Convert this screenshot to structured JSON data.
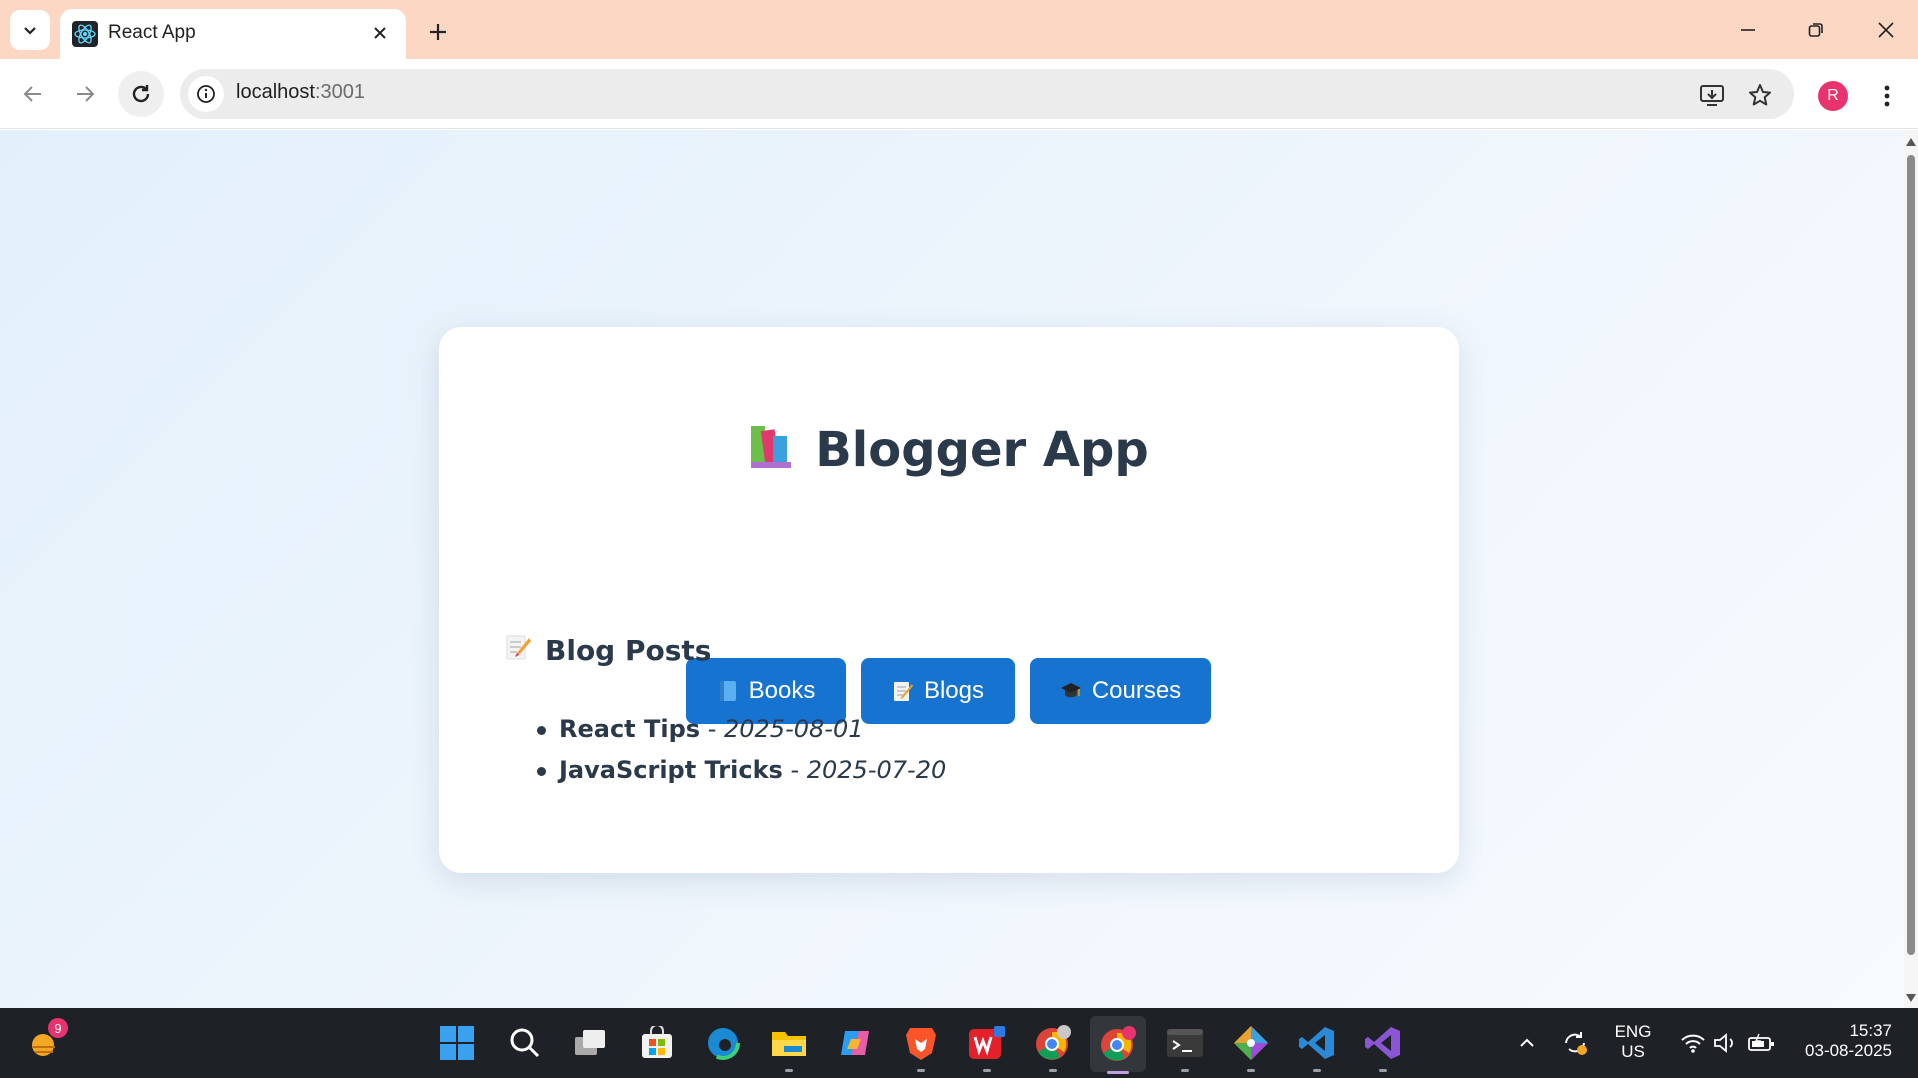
{
  "browser": {
    "tab_title": "React App",
    "url_host": "localhost",
    "url_port": ":3001",
    "profile_initial": "R"
  },
  "app": {
    "title": "Blogger App",
    "nav_buttons": [
      {
        "label": "Books"
      },
      {
        "label": "Blogs"
      },
      {
        "label": "Courses"
      }
    ],
    "section_title": "Blog Posts",
    "posts": [
      {
        "title": "React Tips",
        "separator": " - ",
        "date": "2025-08-01"
      },
      {
        "title": "JavaScript Tricks",
        "separator": " - ",
        "date": "2025-07-20"
      }
    ]
  },
  "taskbar": {
    "notification_count": "9",
    "language": "ENG",
    "region": "US",
    "time": "15:37",
    "date": "03-08-2025"
  },
  "colors": {
    "tabstrip": "#fcd8c4",
    "button": "#1674d0",
    "heading": "#2a3a4a",
    "profile": "#e8336e"
  }
}
